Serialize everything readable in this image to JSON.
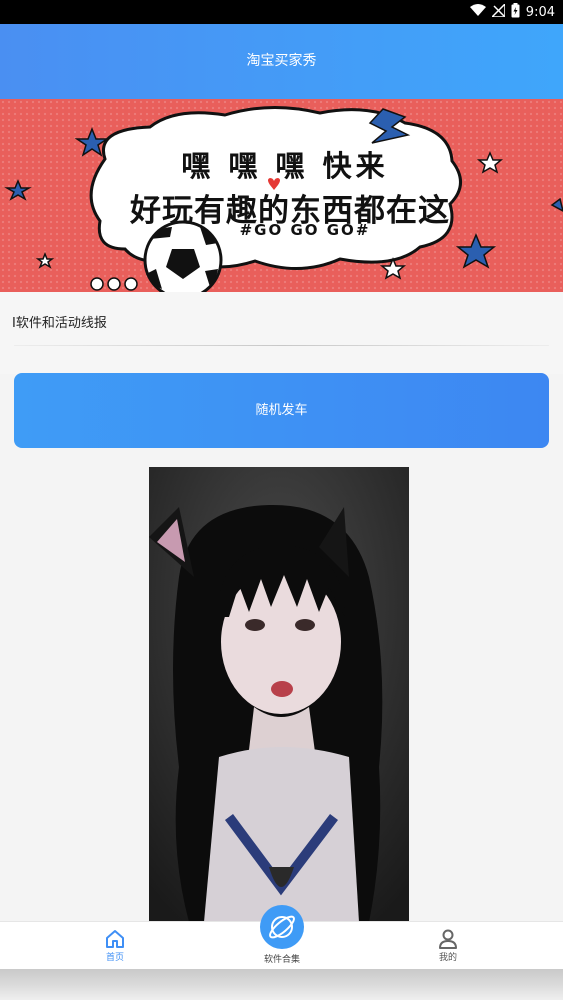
{
  "status_bar": {
    "time": "9:04"
  },
  "header": {
    "title": "淘宝买家秀"
  },
  "banner": {
    "line1": "嘿 嘿 嘿 快来",
    "line2": "好玩有趣的东西都在这",
    "tag": "#GO GO GO#"
  },
  "notice": {
    "text": "I软件和活动线报"
  },
  "action": {
    "random_label": "随机发车"
  },
  "tabbar": {
    "home_label": "首页",
    "center_label": "软件合集",
    "mine_label": "我的"
  },
  "colors": {
    "header_start": "#4a8ff2",
    "header_end": "#3fa6fb",
    "banner_red": "#e95f5b",
    "button_blue": "#3d87f2",
    "active_tab": "#3f8ff5"
  },
  "icons": [
    "wifi-icon",
    "signal-icon",
    "battery-icon",
    "home-icon",
    "planet-icon",
    "user-icon"
  ]
}
